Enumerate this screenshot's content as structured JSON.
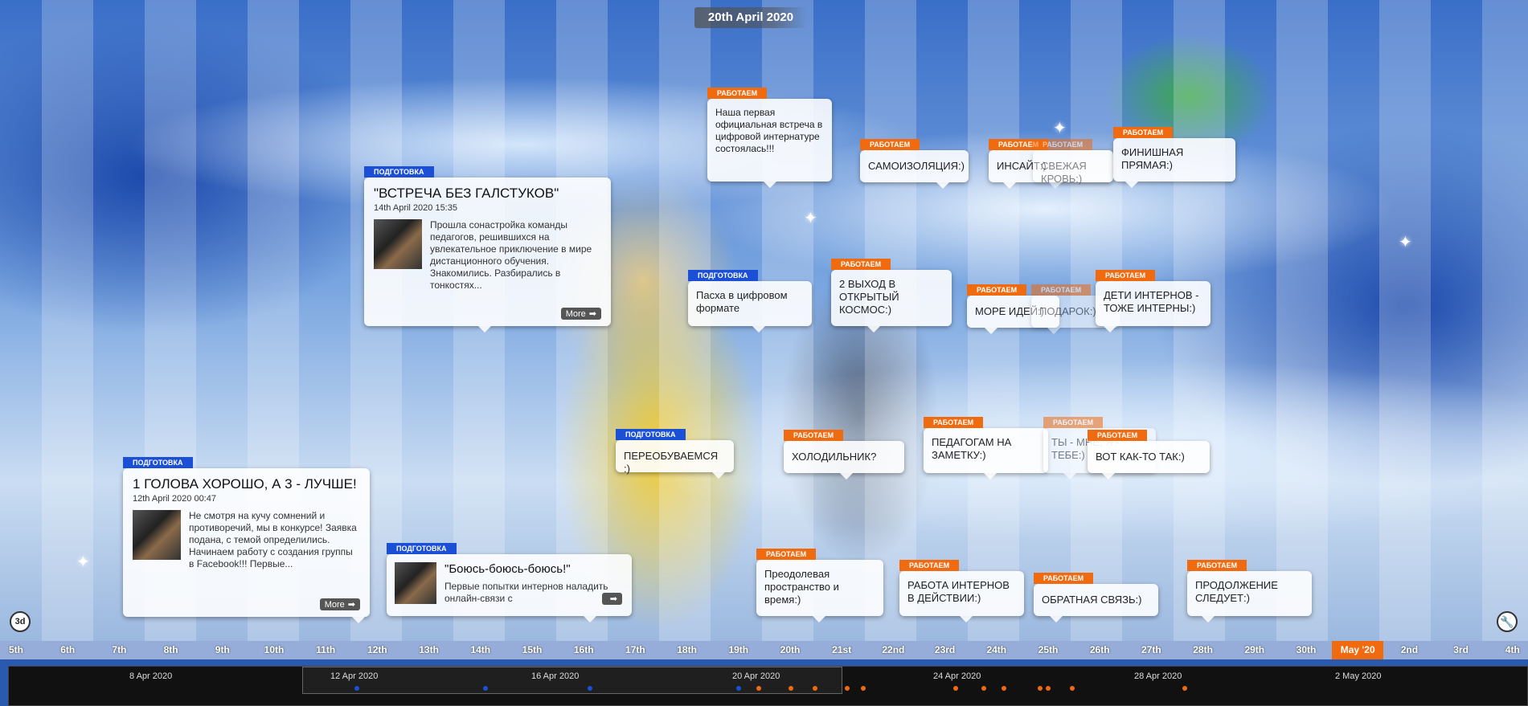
{
  "header": {
    "current_date": "20th April 2020"
  },
  "colors": {
    "tag_blue": "#1a4fd6",
    "tag_orange": "#f06a0f",
    "highlight": "#f06a0f"
  },
  "controls": {
    "view_3d_label": "3d",
    "settings_icon": "wrench-icon"
  },
  "more_label": "More",
  "events": {
    "e1": {
      "tag": "ПОДГОТОВКА",
      "title": "1 ГОЛОВА ХОРОШО, А 3 - ЛУЧШЕ!",
      "date": "12th April 2020 00:47",
      "desc": "Не смотря на кучу сомнений и противоречий, мы в конкурсе! Заявка подана, с темой определились. Начинаем работу с создания группы в Facebook!!! Первые..."
    },
    "e2": {
      "tag": "ПОДГОТОВКА",
      "title": "\"ВСТРЕЧА БЕЗ ГАЛСТУКОВ\"",
      "date": "14th April 2020 15:35",
      "desc": "Прошла сонастройка команды педагогов, решившихся на увлекательное приключение в мире дистанционного обучения. Знакомились. Разбирались в тонкостях..."
    },
    "e3": {
      "tag": "ПОДГОТОВКА",
      "title": "\"Боюсь-боюсь-боюсь!\"",
      "desc": "Первые попытки интернов наладить онлайн-связи с"
    },
    "e4": {
      "tag": "ПОДГОТОВКА",
      "text": "Пасха в цифровом формате"
    },
    "e5": {
      "tag": "ПОДГОТОВКА",
      "text": "ПЕРЕОБУВАЕМСЯ :)"
    },
    "e6": {
      "tag": "РАБОТАЕМ",
      "text": "Наша первая официальная встреча в цифровой интернатуре состоялась!!!"
    },
    "e7": {
      "tag": "РАБОТАЕМ",
      "text": "САМОИЗОЛЯЦИЯ:)"
    },
    "e8": {
      "tag": "РАБОТАЕМ",
      "text": "ИНСАЙТ:)"
    },
    "e9": {
      "tag": "РАБОТАЕМ",
      "text": "СВЕЖАЯ КРОВЬ:)"
    },
    "e10": {
      "tag": "РАБОТАЕМ",
      "text": "ФИНИШНАЯ ПРЯМАЯ:)"
    },
    "e11": {
      "tag": "РАБОТАЕМ",
      "text": "2 ВЫХОД В ОТКРЫТЫЙ КОСМОС:)"
    },
    "e12": {
      "tag": "РАБОТАЕМ",
      "text": "МОРЕ ИДЕЙ:)"
    },
    "e13": {
      "tag": "РАБОТАЕМ",
      "text": "ПОДАРОК:)"
    },
    "e14": {
      "tag": "РАБОТАЕМ",
      "text": "ДЕТИ ИНТЕРНОВ - ТОЖЕ ИНТЕРНЫ:)"
    },
    "e15": {
      "tag": "РАБОТАЕМ",
      "text": "ХОЛОДИЛЬНИК?"
    },
    "e16": {
      "tag": "РАБОТАЕМ",
      "text": "ПЕДАГОГАМ НА ЗАМЕТКУ:)"
    },
    "e17": {
      "tag": "РАБОТАЕМ",
      "text": "ТЫ - МНЕ, Я - ТЕБЕ:)"
    },
    "e18": {
      "tag": "РАБОТАЕМ",
      "text": "ВОТ КАК-ТО ТАК:)"
    },
    "e19": {
      "tag": "РАБОТАЕМ",
      "text": "Преодолевая пространство и время:)"
    },
    "e20": {
      "tag": "РАБОТАЕМ",
      "text": "РАБОТА ИНТЕРНОВ В ДЕЙСТВИИ:)"
    },
    "e21": {
      "tag": "РАБОТАЕМ",
      "text": "ОБРАТНАЯ СВЯЗЬ:)"
    },
    "e22": {
      "tag": "РАБОТАЕМ",
      "text": "ПРОДОЛЖЕНИЕ СЛЕДУЕТ:)"
    }
  },
  "axis_ticks": [
    "5th",
    "6th",
    "7th",
    "8th",
    "9th",
    "10th",
    "11th",
    "12th",
    "13th",
    "14th",
    "15th",
    "16th",
    "17th",
    "18th",
    "19th",
    "20th",
    "21st",
    "22nd",
    "23rd",
    "24th",
    "25th",
    "26th",
    "27th",
    "28th",
    "29th",
    "30th",
    "May '20",
    "2nd",
    "3rd",
    "4th"
  ],
  "axis_highlight": "May '20",
  "minimap_labels": [
    "8 Apr 2020",
    "12 Apr 2020",
    "16 Apr 2020",
    "20 Apr 2020",
    "24 Apr 2020",
    "28 Apr 2020",
    "2 May 2020"
  ]
}
